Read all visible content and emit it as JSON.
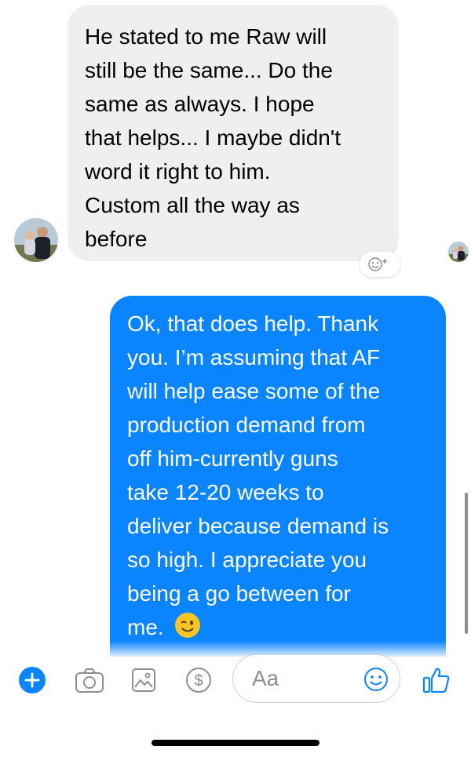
{
  "conversation": {
    "received_message": "He stated to me Raw will\nstill be the same... Do the\nsame as always.  I hope\nthat helps... I maybe didn't\nword it right to him.\nCustom all the way as\nbefore",
    "sent_message": "Ok, that does help.  Thank\nyou.  I’m assuming that AF\nwill help ease some of the\nproduction demand from\noff him-currently guns\ntake 12-20 weeks to\ndeliver because demand is\nso high.  I appreciate you\nbeing a go between for\nme.",
    "sent_emoji": "winking-face",
    "bubble_colors": {
      "received": "#efeff0",
      "sent": "#0b84ff"
    }
  },
  "composer": {
    "placeholder": "Aa",
    "accent": "#0b84ff",
    "icons": [
      "plus-icon",
      "camera-icon",
      "photo-icon",
      "dollar-icon",
      "emoji-icon",
      "thumbs-up-icon"
    ]
  }
}
